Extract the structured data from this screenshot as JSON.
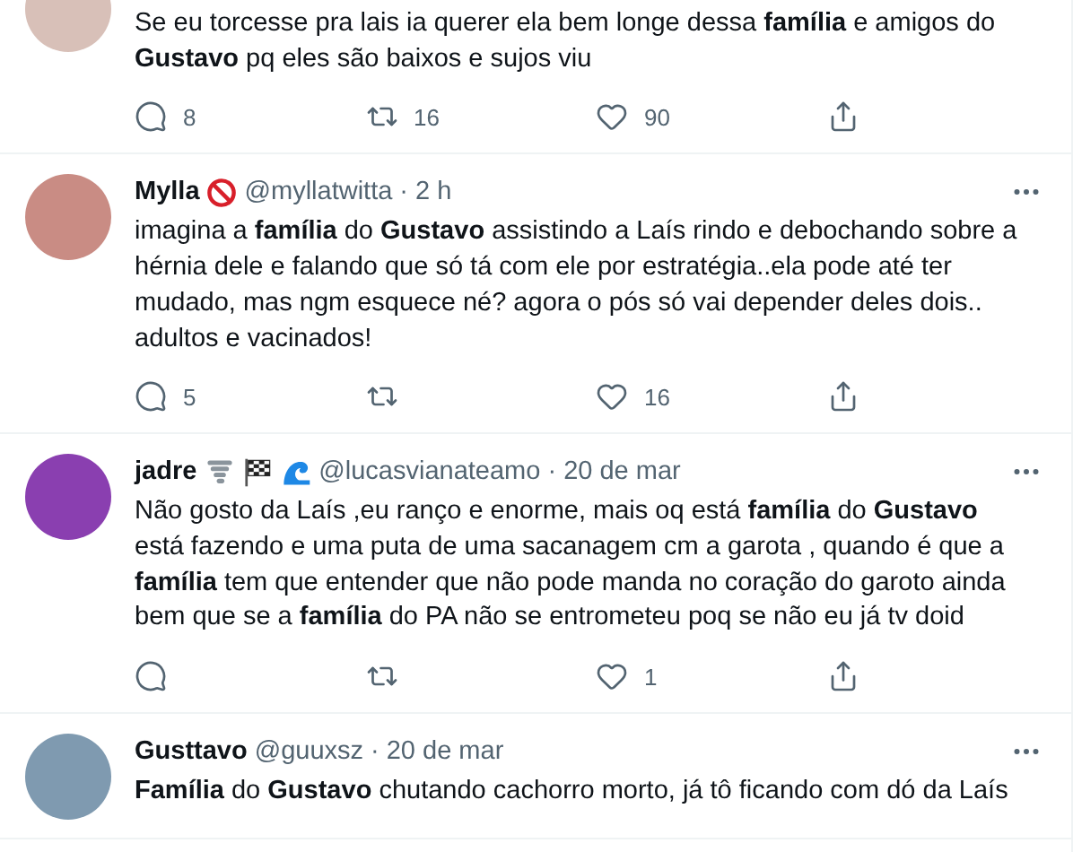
{
  "tweets": [
    {
      "text": "Se eu torcesse pra lais ia querer ela bem longe dessa **família** e amigos do\n**Gustavo** pq eles são baixos e sujos viu",
      "actions": [
        {
          "kind": "reply",
          "count": "8"
        },
        {
          "kind": "retweet",
          "count": "16"
        },
        {
          "kind": "like",
          "count": "90"
        },
        {
          "kind": "share"
        }
      ]
    },
    {
      "name": "Mylla",
      "badges": [
        {
          "kind": "prohibited"
        }
      ],
      "handle": "@myllatwitta",
      "separator": "·",
      "time": "2 h",
      "text": "imagina a **família** do **Gustavo** assistindo a Laís rindo e debochando sobre a\nhérnia dele e falando que só tá com ele por estratégia..ela pode até ter\nmudado, mas ngm esquece né? agora o pós só vai depender deles dois..\nadultos e vacinados!",
      "actions": [
        {
          "kind": "reply",
          "count": "5"
        },
        {
          "kind": "retweet"
        },
        {
          "kind": "like",
          "count": "16"
        },
        {
          "kind": "share"
        }
      ]
    },
    {
      "name": "jadre",
      "badges": [
        {
          "kind": "tornado"
        },
        {
          "kind": "flag"
        },
        {
          "kind": "wave"
        }
      ],
      "handle": "@lucasvianateamo",
      "separator": "·",
      "time": "20 de mar",
      "text": "Não gosto da Laís ,eu ranço e enorme, mais oq está **família** do **Gustavo**\nestá fazendo e uma puta de uma sacanagem cm a garota , quando é que a\n**família** tem que entender que não pode manda no coração do garoto ainda\nbem que se a **família** do PA não se entrometeu poq se não eu já tv doid",
      "actions": [
        {
          "kind": "reply"
        },
        {
          "kind": "retweet"
        },
        {
          "kind": "like",
          "count": "1"
        },
        {
          "kind": "share"
        }
      ]
    },
    {
      "name": "Gusttavo",
      "handle": "@guuxsz",
      "separator": "·",
      "time": "20 de mar",
      "text": "**Família** do **Gustavo** chutando cachorro morto, já tô ficando com dó da Laís"
    }
  ]
}
